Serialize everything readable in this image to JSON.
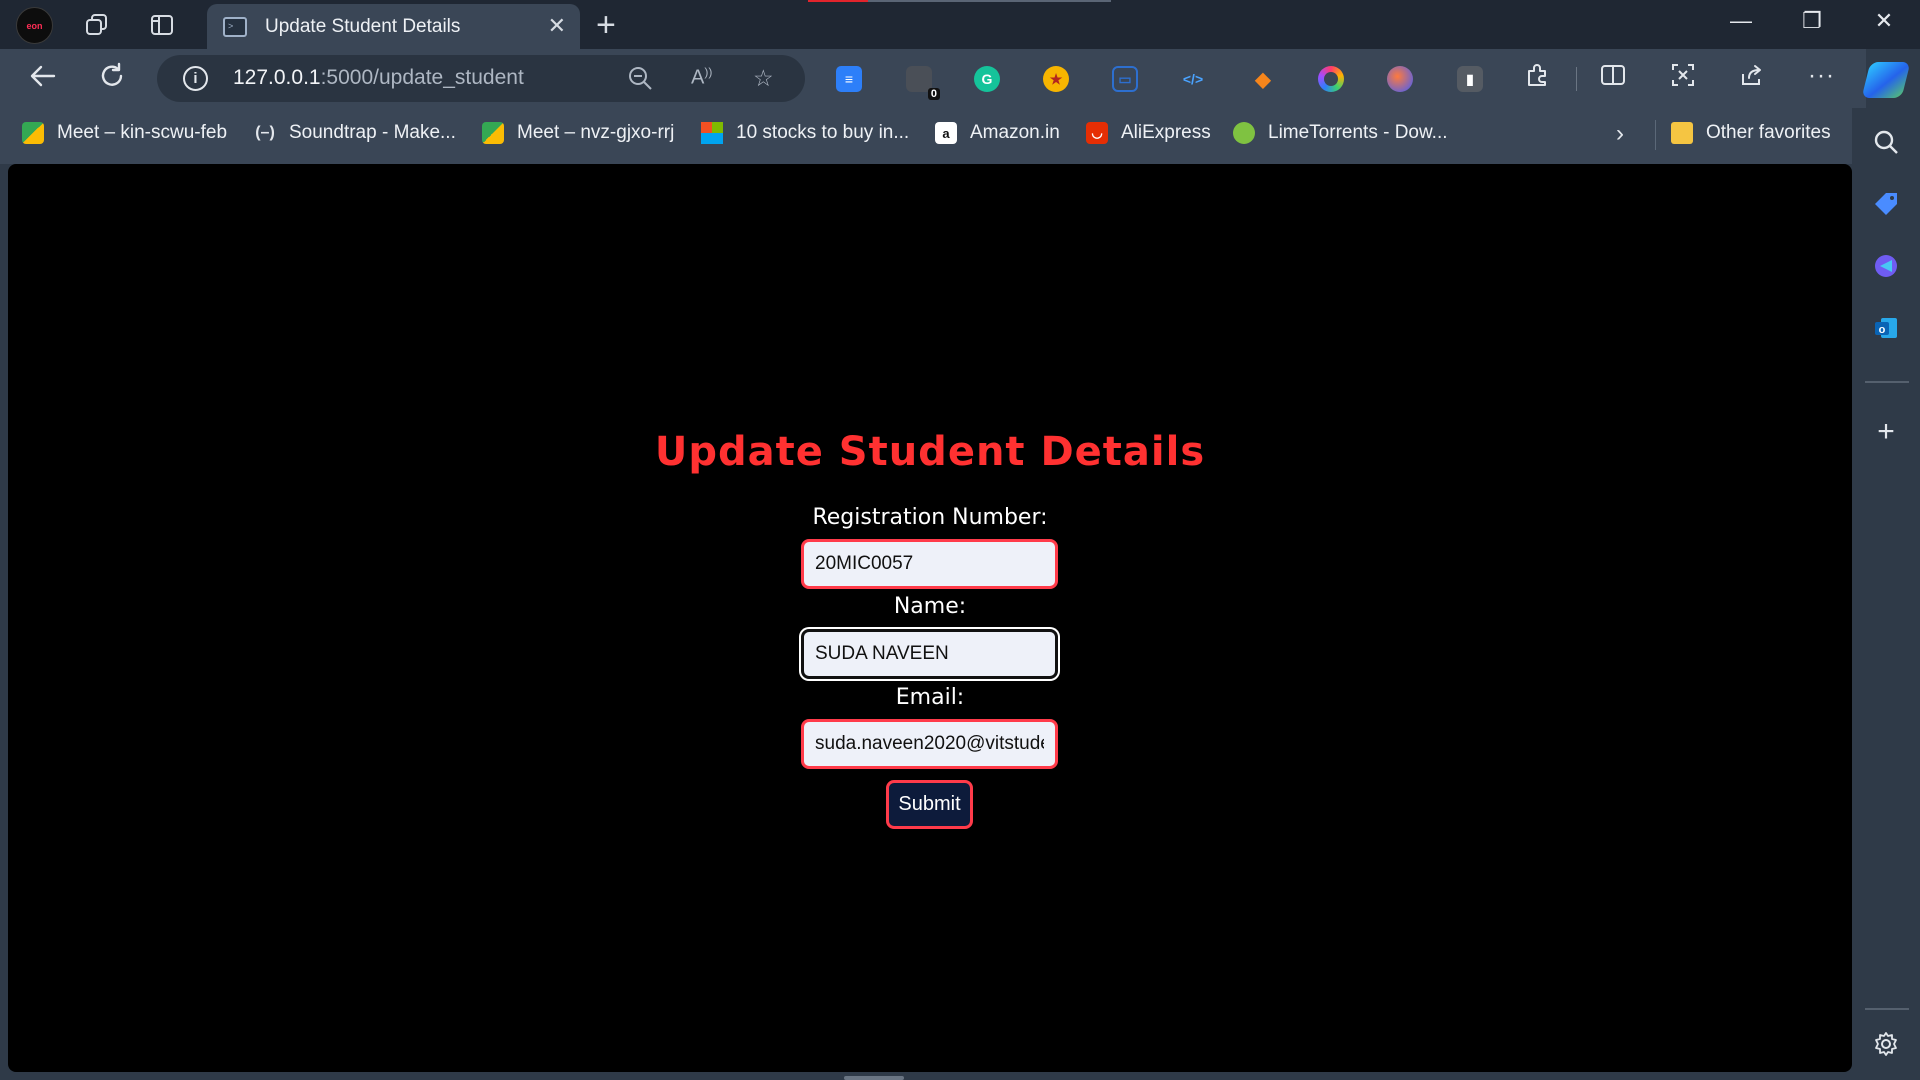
{
  "tab": {
    "title": "Update Student Details",
    "close": "✕",
    "new_tab": "+"
  },
  "profile": {
    "badge": "eon"
  },
  "window_controls": {
    "minimize": "—",
    "restore": "❐",
    "close": "✕"
  },
  "address_bar": {
    "host": "127.0.0.1",
    "path": ":5000/update_student",
    "info": "i"
  },
  "extensions": {
    "badge_count": "0"
  },
  "bookmarks": [
    {
      "label": "Meet – kin-scwu-feb"
    },
    {
      "label": "Soundtrap - Make..."
    },
    {
      "label": "Meet – nvz-gjxo-rrj"
    },
    {
      "label": "10 stocks to buy in..."
    },
    {
      "label": "Amazon.in"
    },
    {
      "label": "AliExpress"
    },
    {
      "label": "LimeTorrents - Dow..."
    }
  ],
  "other_favorites": "Other favorites",
  "page": {
    "title": "Update Student Details",
    "reg_label": "Registration Number:",
    "reg_value": "20MIC0057",
    "name_label": "Name:",
    "name_value": "SUDA NAVEEN",
    "email_label": "Email:",
    "email_value": "suda.naveen2020@vitstude",
    "submit_label": "Submit"
  },
  "colors": {
    "title_red": "#ff3131",
    "field_border": "#ff3b4a",
    "submit_bg": "#0d1b3b",
    "page_bg": "#000000",
    "chrome_bg": "#3a4656"
  }
}
